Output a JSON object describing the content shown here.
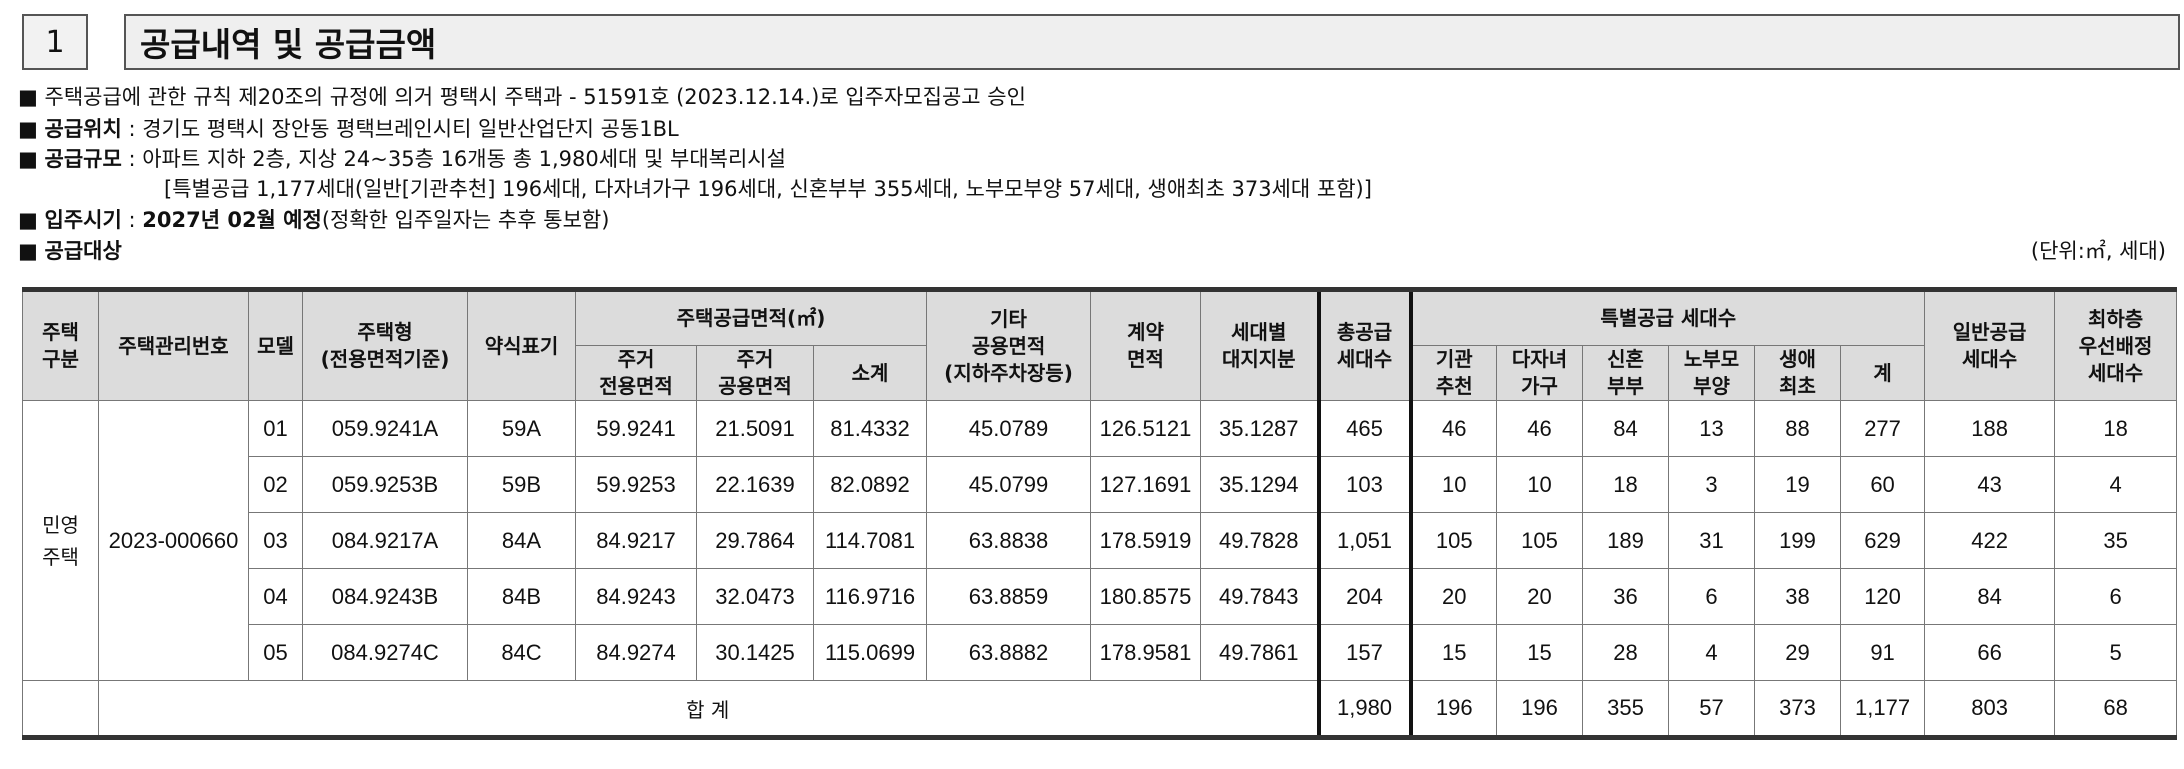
{
  "header": {
    "section_number": "1",
    "section_title": "공급내역 및 공급금액"
  },
  "notes": {
    "bullet": "■",
    "approval": "주택공급에 관한 규칙 제20조의 규정에 의거 평택시 주택과 - 51591호 (2023.12.14.)로 입주자모집공고 승인",
    "location_label": "공급위치",
    "location_value": " : 경기도 평택시 장안동 평택브레인시티 일반산업단지 공동1BL",
    "scale_label": "공급규모",
    "scale_value": " : 아파트 지하 2층, 지상 24~35층 16개동 총 1,980세대 및 부대복리시설",
    "scale_detail": "[특별공급 1,177세대(일반[기관추천] 196세대, 다자녀가구 196세대, 신혼부부 355세대, 노부모부양 57세대, 생애최초 373세대 포함)]",
    "movein_label": "입주시기",
    "movein_sep": " : ",
    "movein_value": "2027년 02월 예정",
    "movein_note": "(정확한 입주일자는 추후 통보함)",
    "target_label": "공급대상",
    "unit_text": "(단위:㎡, 세대)"
  },
  "table": {
    "headers": {
      "housing_type": "주택\n구분",
      "mgmt_no": "주택관리번호",
      "model": "모델",
      "unit_type": "주택형\n(전용면적기준)",
      "abbr": "약식표기",
      "area_group": "주택공급면적(㎡)",
      "exclusive": "주거\n전용면적",
      "common": "주거\n공용면적",
      "subtotal": "소계",
      "other_common": "기타\n공용면적\n(지하주차장등)",
      "contract_area": "계약\n면적",
      "land_share": "세대별\n대지지분",
      "total_units": "총공급\n세대수",
      "special_group": "특별공급 세대수",
      "inst": "기관\n추천",
      "multi": "다자녀\n가구",
      "newlywed": "신혼\n부부",
      "elderly": "노부모\n부양",
      "first": "생애\n최초",
      "sum": "계",
      "general": "일반공급\n세대수",
      "lowest_floor": "최하층\n우선배정\n세대수"
    },
    "housing_type_value": "민영\n주택",
    "mgmt_no_value": "2023-000660",
    "rows": [
      {
        "model": "01",
        "type": "059.9241A",
        "abbr": "59A",
        "excl": "59.9241",
        "comm": "21.5091",
        "sub": "81.4332",
        "other": "45.0789",
        "contract": "126.5121",
        "land": "35.1287",
        "total": "465",
        "inst": "46",
        "multi": "46",
        "newlywed": "84",
        "elderly": "13",
        "first": "88",
        "sum": "277",
        "general": "188",
        "lowest": "18"
      },
      {
        "model": "02",
        "type": "059.9253B",
        "abbr": "59B",
        "excl": "59.9253",
        "comm": "22.1639",
        "sub": "82.0892",
        "other": "45.0799",
        "contract": "127.1691",
        "land": "35.1294",
        "total": "103",
        "inst": "10",
        "multi": "10",
        "newlywed": "18",
        "elderly": "3",
        "first": "19",
        "sum": "60",
        "general": "43",
        "lowest": "4"
      },
      {
        "model": "03",
        "type": "084.9217A",
        "abbr": "84A",
        "excl": "84.9217",
        "comm": "29.7864",
        "sub": "114.7081",
        "other": "63.8838",
        "contract": "178.5919",
        "land": "49.7828",
        "total": "1,051",
        "inst": "105",
        "multi": "105",
        "newlywed": "189",
        "elderly": "31",
        "first": "199",
        "sum": "629",
        "general": "422",
        "lowest": "35"
      },
      {
        "model": "04",
        "type": "084.9243B",
        "abbr": "84B",
        "excl": "84.9243",
        "comm": "32.0473",
        "sub": "116.9716",
        "other": "63.8859",
        "contract": "180.8575",
        "land": "49.7843",
        "total": "204",
        "inst": "20",
        "multi": "20",
        "newlywed": "36",
        "elderly": "6",
        "first": "38",
        "sum": "120",
        "general": "84",
        "lowest": "6"
      },
      {
        "model": "05",
        "type": "084.9274C",
        "abbr": "84C",
        "excl": "84.9274",
        "comm": "30.1425",
        "sub": "115.0699",
        "other": "63.8882",
        "contract": "178.9581",
        "land": "49.7861",
        "total": "157",
        "inst": "15",
        "multi": "15",
        "newlywed": "28",
        "elderly": "4",
        "first": "29",
        "sum": "91",
        "general": "66",
        "lowest": "5"
      }
    ],
    "total_row": {
      "label": "합 계",
      "total": "1,980",
      "inst": "196",
      "multi": "196",
      "newlywed": "355",
      "elderly": "57",
      "first": "373",
      "sum": "1,177",
      "general": "803",
      "lowest": "68"
    }
  }
}
